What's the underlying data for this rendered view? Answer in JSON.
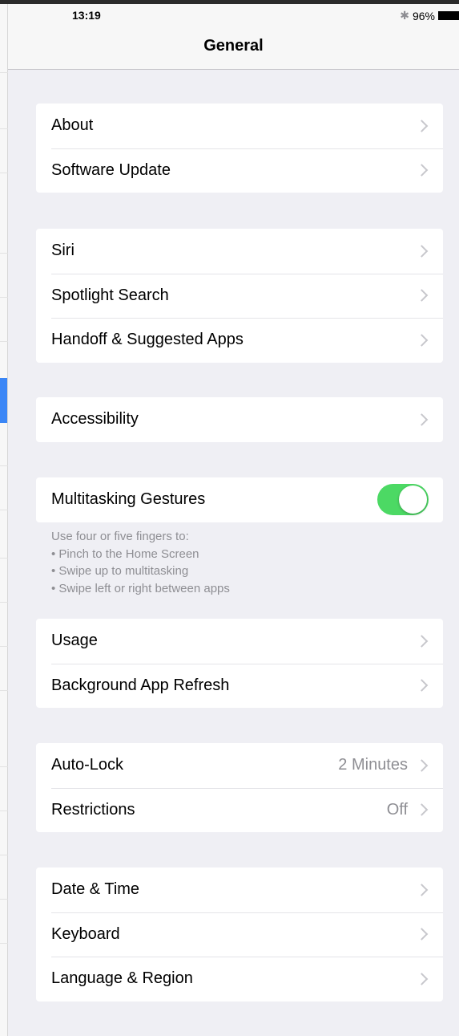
{
  "status_bar": {
    "time": "13:19",
    "bluetooth_icon": "bluetooth-icon",
    "battery_percent": "96%",
    "battery_icon": "battery-icon"
  },
  "nav": {
    "title": "General"
  },
  "groups": [
    [
      {
        "label": "About"
      },
      {
        "label": "Software Update"
      }
    ],
    [
      {
        "label": "Siri"
      },
      {
        "label": "Spotlight Search"
      },
      {
        "label": "Handoff & Suggested Apps"
      }
    ],
    [
      {
        "label": "Accessibility"
      }
    ],
    [
      {
        "label": "Multitasking Gestures",
        "toggle_on": true
      }
    ],
    [
      {
        "label": "Usage"
      },
      {
        "label": "Background App Refresh"
      }
    ],
    [
      {
        "label": "Auto-Lock",
        "value": "2 Minutes"
      },
      {
        "label": "Restrictions",
        "value": "Off"
      }
    ],
    [
      {
        "label": "Date & Time"
      },
      {
        "label": "Keyboard"
      },
      {
        "label": "Language & Region"
      }
    ]
  ],
  "multitasking_note": [
    "Use four or five fingers to:",
    "• Pinch to the Home Screen",
    "• Swipe up to multitasking",
    "• Swipe left or right between apps"
  ],
  "colors": {
    "toggle_on": "#4cd964",
    "background": "#efeff4",
    "accent_blue": "#3b86f6"
  }
}
